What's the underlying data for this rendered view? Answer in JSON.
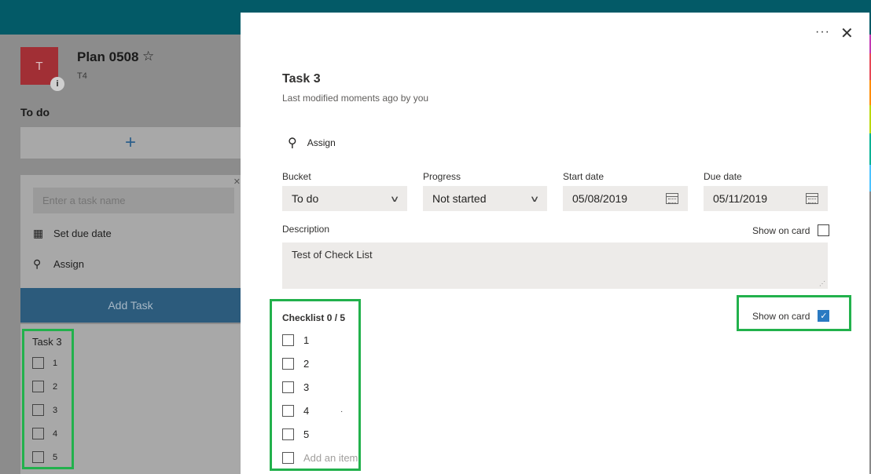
{
  "board": {
    "avatar_letter": "T",
    "avatar_info": "i",
    "plan_title": "Plan 0508",
    "plan_subtitle": "T4",
    "bucket_name": "To do",
    "add_icon": "+",
    "new_card": {
      "task_name_placeholder": "Enter a task name",
      "due_date_label": "Set due date",
      "assign_label": "Assign",
      "add_task_label": "Add Task"
    },
    "task_card": {
      "title": "Task 3",
      "items": [
        "1",
        "2",
        "3",
        "4",
        "5"
      ]
    }
  },
  "detail": {
    "more_icon": "···",
    "close_icon": "✕",
    "title": "Task 3",
    "modified": "Last modified moments ago by you",
    "assign_label": "Assign",
    "fields": {
      "bucket": {
        "label": "Bucket",
        "value": "To do"
      },
      "progress": {
        "label": "Progress",
        "value": "Not started"
      },
      "start_date": {
        "label": "Start date",
        "value": "05/08/2019"
      },
      "due_date": {
        "label": "Due date",
        "value": "05/11/2019"
      }
    },
    "description": {
      "label": "Description",
      "value": "Test of Check List",
      "show_on_card_label": "Show on card",
      "show_on_card_checked": false
    },
    "checklist": {
      "title": "Checklist 0 / 5",
      "show_on_card_label": "Show on card",
      "show_on_card_checked": true,
      "items": [
        "1",
        "2",
        "3",
        "4",
        "5"
      ],
      "add_placeholder": "Add an item"
    }
  },
  "colors": {
    "topbar": "#035a67",
    "avatar": "#a4262c",
    "add_task_button": "#2c5b7c",
    "highlight_box": "#22b14c",
    "checkbox_checked": "#2a7ac2",
    "side_strips": [
      "#e74856",
      "#ff8c00",
      "#fce100",
      "#bad80a",
      "#00b294",
      "#4cc2ff",
      "#c239b3"
    ]
  }
}
